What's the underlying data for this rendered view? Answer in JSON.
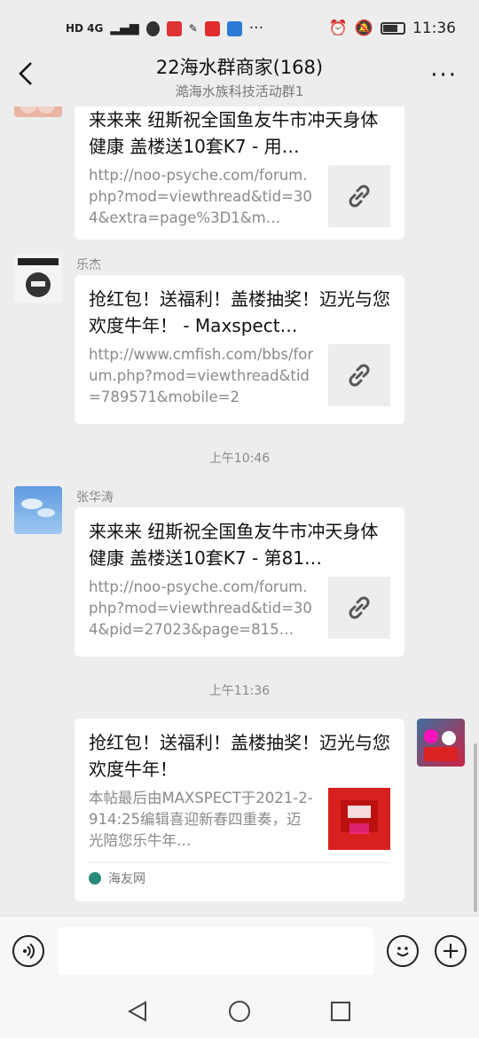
{
  "status_bar": {
    "network": "HD 4G",
    "time": "11:36",
    "app_icons": [
      "qq-icon",
      "red-app-icon",
      "text-app-icon",
      "red-envelope-app-icon",
      "blue-app-icon",
      "more-dots"
    ],
    "right_icons": [
      "alarm-icon",
      "mute-icon",
      "battery-icon"
    ]
  },
  "header": {
    "title": "22海水群商家(168)",
    "subtitle": "澔海水族科技活动群1",
    "back_icon": "chevron-left-icon",
    "more_icon": "more-dots-icon",
    "more_label": "···"
  },
  "messages": [
    {
      "title": "来来来 纽斯祝全国鱼友牛市冲天身体健康 盖楼送10套K7 - 用…",
      "desc": "http://noo-psyche.com/forum.php?mod=viewthread&tid=304&extra=page%3D1&m…"
    },
    {
      "sender": "乐杰",
      "title": "抢红包！送福利！盖楼抽奖！迈光与您欢度牛年！ - Maxspect…",
      "desc": "http://www.cmfish.com/bbs/forum.php?mod=viewthread&tid=789571&mobile=2"
    },
    {
      "time": "上午10:46"
    },
    {
      "sender": "张华涛",
      "title": "来来来 纽斯祝全国鱼友牛市冲天身体健康 盖楼送10套K7 - 第81…",
      "desc": "http://noo-psyche.com/forum.php?mod=viewthread&tid=304&pid=27023&page=815…"
    },
    {
      "time": "上午11:36"
    },
    {
      "title": "抢红包！送福利！盖楼抽奖！迈光与您欢度牛年！",
      "desc": "本帖最后由MAXSPECT于2021-2-914:25编辑喜迎新春四重奏，迈光陪您乐牛年…",
      "source": "海友网"
    }
  ],
  "input_bar": {
    "voice_icon": "voice-icon",
    "emoji_icon": "emoji-icon",
    "plus_icon": "plus-icon",
    "plus_label": "+"
  },
  "nav_bar": [
    "back-nav-icon",
    "home-nav-icon",
    "recents-nav-icon"
  ],
  "colors": {
    "background": "#ededed",
    "card": "#ffffff",
    "muted_text": "#8a8a8a"
  }
}
